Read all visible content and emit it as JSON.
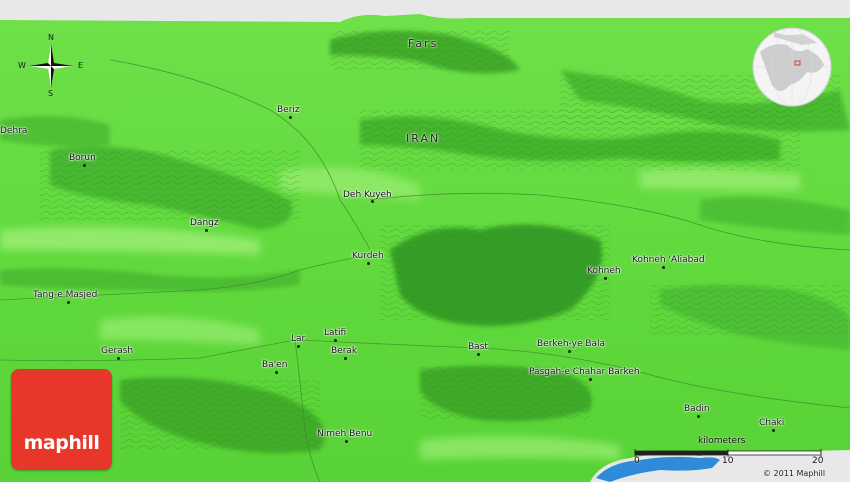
{
  "map": {
    "regions": [
      {
        "name": "Fars",
        "key": "fars"
      },
      {
        "name": "IRAN",
        "key": "iran"
      }
    ],
    "places": [
      {
        "name": "Dehra",
        "key": "dehra"
      },
      {
        "name": "Beriz",
        "key": "beriz"
      },
      {
        "name": "Borun",
        "key": "borun"
      },
      {
        "name": "Deh Kuyeh",
        "key": "deh-kuyeh"
      },
      {
        "name": "Dangz",
        "key": "dangz"
      },
      {
        "name": "Kurdeh",
        "key": "kurdeh"
      },
      {
        "name": "Kohneh",
        "key": "kohneh"
      },
      {
        "name": "Kohneh 'Aliabad",
        "key": "kohneh-aliabad"
      },
      {
        "name": "Tang-e Masjed",
        "key": "tang-e-masjed"
      },
      {
        "name": "Latifi",
        "key": "latifi"
      },
      {
        "name": "Lar",
        "key": "lar"
      },
      {
        "name": "Gerash",
        "key": "gerash"
      },
      {
        "name": "Berak",
        "key": "berak"
      },
      {
        "name": "Bast",
        "key": "bast"
      },
      {
        "name": "Berkeh-ye Bala",
        "key": "berkeh-ye-bala"
      },
      {
        "name": "Ba'en",
        "key": "baen"
      },
      {
        "name": "Pasgah-e Chahar Barkeh",
        "key": "pasgah-e-chahar-barkeh"
      },
      {
        "name": "Badin",
        "key": "badin"
      },
      {
        "name": "Chaki",
        "key": "chaki"
      },
      {
        "name": "Nimeh Benu",
        "key": "nimeh-benu"
      }
    ],
    "compass": {
      "n": "N",
      "s": "S",
      "e": "E",
      "w": "W"
    },
    "scale": {
      "unit": "kilometers",
      "ticks": [
        "0",
        "10",
        "20"
      ]
    },
    "logo": "maphill",
    "copyright": "© 2011 Maphill",
    "colors": {
      "land": "#5fd83c",
      "land_dark": "#2f9a22",
      "land_light": "#9ff27a",
      "water": "#2e8bd8",
      "logo": "#e8362a"
    }
  }
}
